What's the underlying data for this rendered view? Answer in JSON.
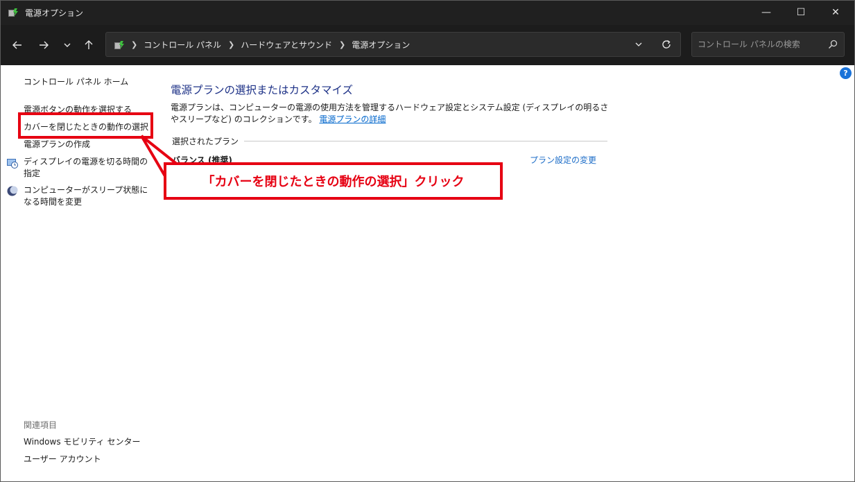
{
  "window": {
    "title": "電源オプション",
    "controls": {
      "minimize": "—",
      "maximize": "☐",
      "close": "✕"
    }
  },
  "navbar": {
    "back_icon": "arrow-left-icon",
    "forward_icon": "arrow-right-icon",
    "recent_icon": "chevron-down-icon",
    "up_icon": "arrow-up-icon",
    "breadcrumbs": [
      "コントロール パネル",
      "ハードウェアとサウンド",
      "電源オプション"
    ],
    "refresh_icon": "refresh-icon"
  },
  "search": {
    "placeholder": "コントロール パネルの検索"
  },
  "sidebar": {
    "home": "コントロール パネル ホーム",
    "items": [
      {
        "label": "電源ボタンの動作を選択する"
      },
      {
        "label": "カバーを閉じたときの動作の選択"
      },
      {
        "label": "電源プランの作成"
      },
      {
        "label": "ディスプレイの電源を切る時間の指定"
      },
      {
        "label": "コンピューターがスリープ状態になる時間を変更"
      }
    ],
    "related_heading": "関連項目",
    "related": [
      {
        "label": "Windows モビリティ センター"
      },
      {
        "label": "ユーザー アカウント"
      }
    ]
  },
  "main": {
    "title": "電源プランの選択またはカスタマイズ",
    "description": "電源プランは、コンピューターの電源の使用方法を管理するハードウェア設定とシステム設定 (ディスプレイの明るさやスリープなど) のコレクションです。",
    "description_link": "電源プランの詳細",
    "section_label": "選択されたプラン",
    "plan_name": "バランス (推奨)",
    "plan_change": "プラン設定の変更"
  },
  "annotation": {
    "highlight_target": "カバーを閉じたときの動作の選択",
    "callout": "「カバーを閉じたときの動作の選択」クリック",
    "color": "#e60012"
  },
  "colors": {
    "titlebar_bg": "#202020",
    "navbar_bg": "#1c1c1c",
    "title_blue": "#1e3287",
    "link_blue": "#1e6ec8"
  }
}
